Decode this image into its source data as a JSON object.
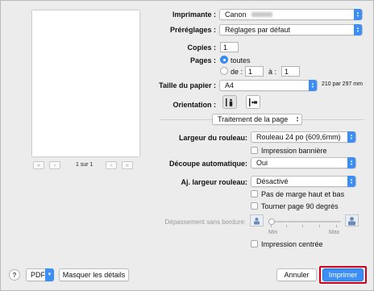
{
  "preview": {
    "page_text": "1 sur 1",
    "first_label": "«",
    "prev_label": "‹",
    "next_label": "›",
    "last_label": "»"
  },
  "printer": {
    "label": "Imprimante :",
    "value": "Canon"
  },
  "presets": {
    "label": "Préréglages :",
    "value": "Réglages par défaut"
  },
  "copies": {
    "label": "Copies :",
    "value": "1"
  },
  "pages": {
    "label": "Pages :",
    "all_label": "toutes",
    "from_label": "de :",
    "from_value": "1",
    "to_label": "à :",
    "to_value": "1",
    "selected": "toutes"
  },
  "paper_size": {
    "label": "Taille du papier :",
    "value": "A4",
    "dimensions": "210 par 297 mm"
  },
  "orientation": {
    "label": "Orientation :",
    "selected": "portrait"
  },
  "section_popup": {
    "value": "Traitement de la page"
  },
  "roll_width": {
    "label": "Largeur du rouleau:",
    "value": "Rouleau 24 po (609,6mm)"
  },
  "banner": {
    "label": "Impression bannière",
    "checked": false
  },
  "auto_cut": {
    "label": "Découpe automatique:",
    "value": "Oui"
  },
  "roll_adjust": {
    "label": "Aj. largeur rouleau:",
    "value": "Désactivé"
  },
  "no_margin": {
    "label": "Pas de marge haut et bas",
    "checked": false
  },
  "rotate": {
    "label": "Tourner page 90 degrés",
    "checked": false
  },
  "borderless": {
    "label": "Dépassement sans bordure:",
    "min_label": "Min",
    "max_label": "Max",
    "level": 0
  },
  "centered": {
    "label": "Impression centrée",
    "checked": false
  },
  "bottom": {
    "help_label": "?",
    "pdf_label": "PDF",
    "hide_details_label": "Masquer les détails",
    "cancel_label": "Annuler",
    "print_label": "Imprimer"
  },
  "colors": {
    "accent": "#3a8ef6",
    "highlight": "#d0021b"
  }
}
